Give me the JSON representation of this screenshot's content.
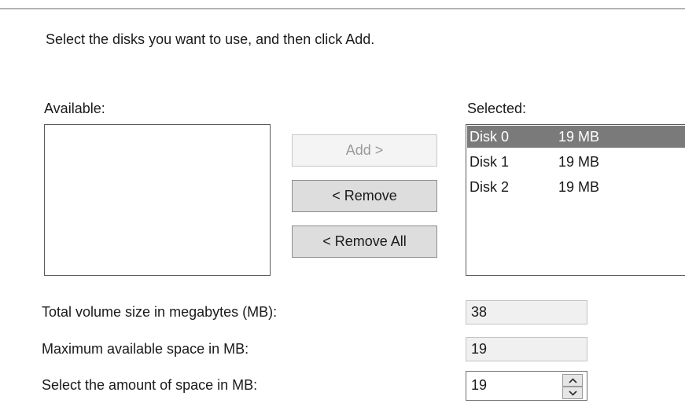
{
  "instruction": "Select the disks you want to use, and then click Add.",
  "available": {
    "label": "Available:",
    "items": []
  },
  "buttons": {
    "add": "Add >",
    "remove": "< Remove",
    "remove_all": "< Remove All"
  },
  "selected": {
    "label": "Selected:",
    "items": [
      {
        "name": "Disk 0",
        "size": "19 MB",
        "highlighted": true
      },
      {
        "name": "Disk 1",
        "size": "19 MB",
        "highlighted": false
      },
      {
        "name": "Disk 2",
        "size": "19 MB",
        "highlighted": false
      }
    ]
  },
  "fields": {
    "total_label": "Total volume size in megabytes (MB):",
    "total_value": "38",
    "max_label": "Maximum available space in MB:",
    "max_value": "19",
    "amount_label": "Select the amount of space in MB:",
    "amount_value": "19"
  },
  "icons": {
    "spin_up": "chevron-up-icon",
    "spin_down": "chevron-down-icon"
  },
  "colors": {
    "selection_highlight": "#7a7a7a",
    "disabled_text": "#9a9a9a"
  }
}
